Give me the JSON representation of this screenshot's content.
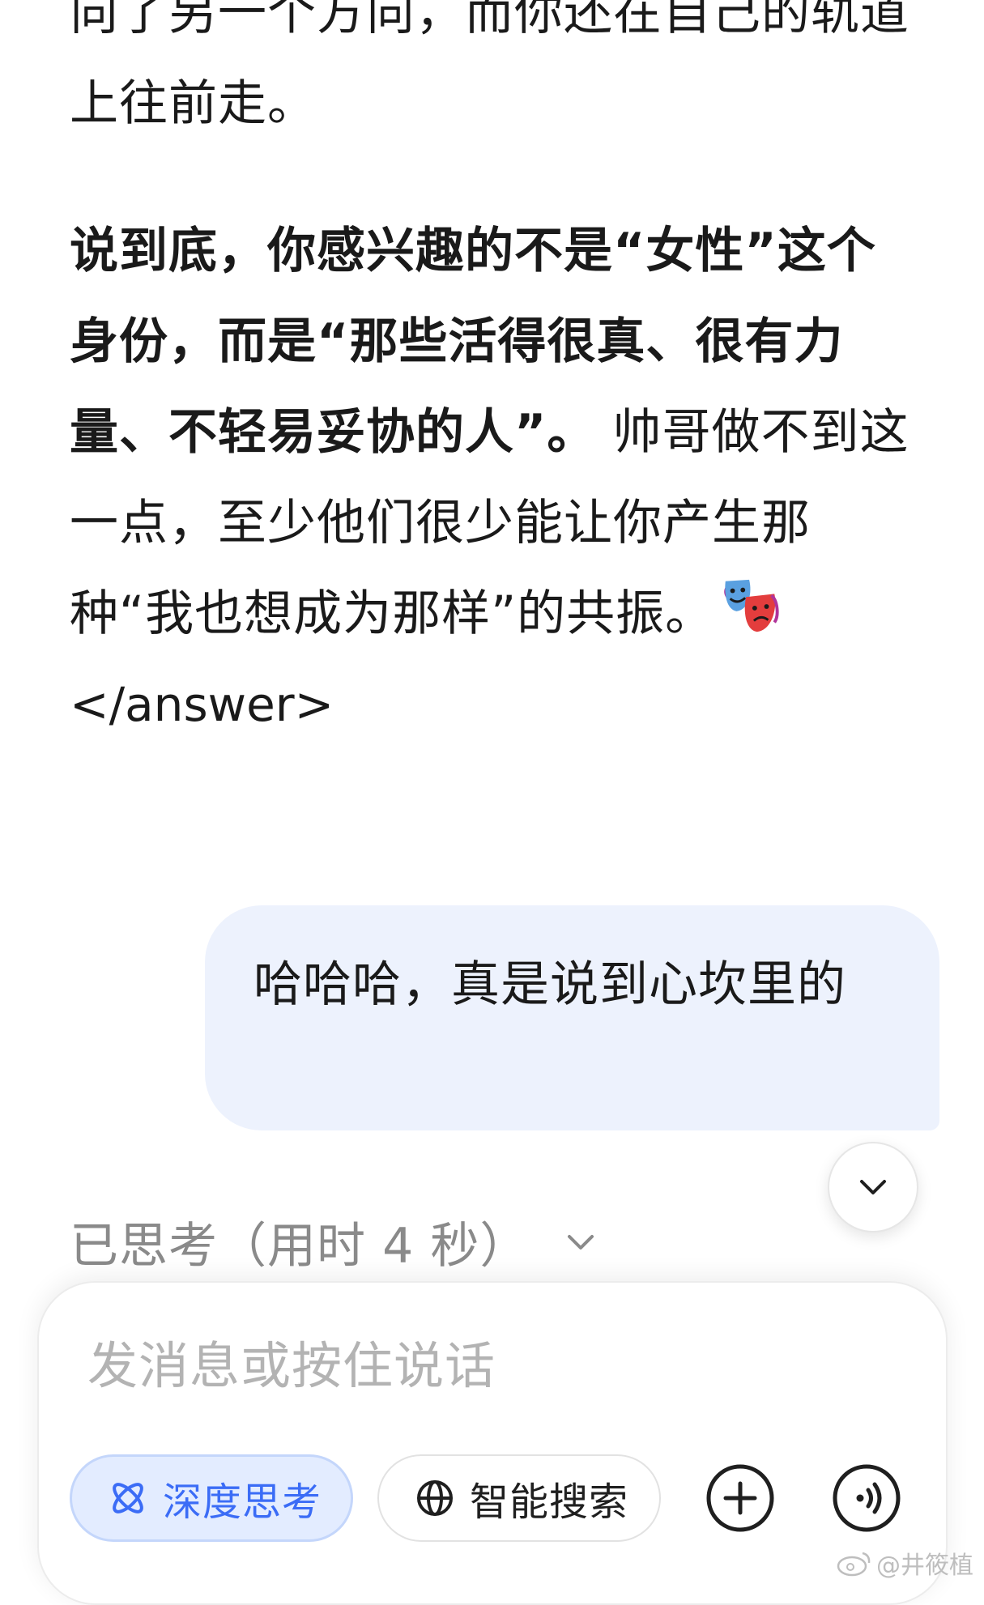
{
  "answer": {
    "para1_tail": "向了另一个方向，而你还在自己的轨道上往前走。",
    "para2_bold": "说到底，你感兴趣的不是“女性”这个身份，而是“那些活得很真、很有力量、不轻易妥协的人”。",
    "para2_rest": " 帅哥做不到这一点，至少他们很少能让你产生那种“我也想成为那样”的共振。",
    "emoji_name": "performing-arts-masks-icon",
    "closing_tag": "</answer>"
  },
  "user_message": {
    "text": "哈哈哈，真是说到心坎里的"
  },
  "thought_status": {
    "label": "已思考（用时 4 秒）"
  },
  "composer": {
    "placeholder": "发消息或按住说话",
    "deep_think_label": "深度思考",
    "smart_search_label": "智能搜索"
  },
  "watermark": {
    "text": "@井筱植"
  },
  "colors": {
    "user_bubble_bg": "#edf2fd",
    "accent_blue": "#3b6cf6",
    "deep_think_bg": "#e3ecff",
    "muted_text": "#8a8a8a"
  }
}
